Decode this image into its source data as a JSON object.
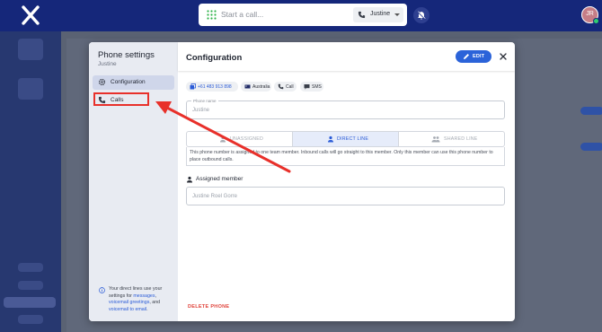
{
  "topbar": {
    "call_placeholder": "Start a call...",
    "caller": "Justine",
    "avatar_initials": "JR"
  },
  "modal": {
    "side": {
      "title": "Phone settings",
      "subtitle": "Justine",
      "items": [
        {
          "label": "Configuration",
          "icon": "gear-icon",
          "active": true
        },
        {
          "label": "Calls",
          "icon": "phone-icon",
          "active": false
        }
      ],
      "info": {
        "prefix": "Your direct lines use your settings for ",
        "link1": "messages",
        "sep1": ", ",
        "link2": "voicemail greetings",
        "sep2": ", and ",
        "link3": "voicemail to email",
        "suffix": "."
      }
    },
    "main": {
      "title": "Configuration",
      "edit_label": "EDIT",
      "chips": [
        {
          "label": "+61 483 913 898",
          "icon": "copy-icon"
        },
        {
          "label": "Australia",
          "icon": "flag-icon"
        },
        {
          "label": "Call",
          "icon": "phone-icon"
        },
        {
          "label": "SMS",
          "icon": "message-icon"
        }
      ],
      "phone_name": {
        "legend": "Phone name",
        "value": "Justine"
      },
      "line_types": [
        {
          "label": "UNASSIGNED",
          "active": false
        },
        {
          "label": "DIRECT LINE",
          "active": true
        },
        {
          "label": "SHARED LINE",
          "active": false
        }
      ],
      "line_description": "This phone number is assigned to one team member. Inbound calls will go straight to this member. Only this member can use this phone number to place outbound calls.",
      "assigned_label": "Assigned member",
      "assigned_value": "Justine Roel Gorre",
      "delete_label": "DELETE PHONE"
    }
  },
  "colors": {
    "topbar": "#15277a",
    "accent": "#2b63d9",
    "annotation": "#e8302a",
    "danger": "#e0433b"
  }
}
